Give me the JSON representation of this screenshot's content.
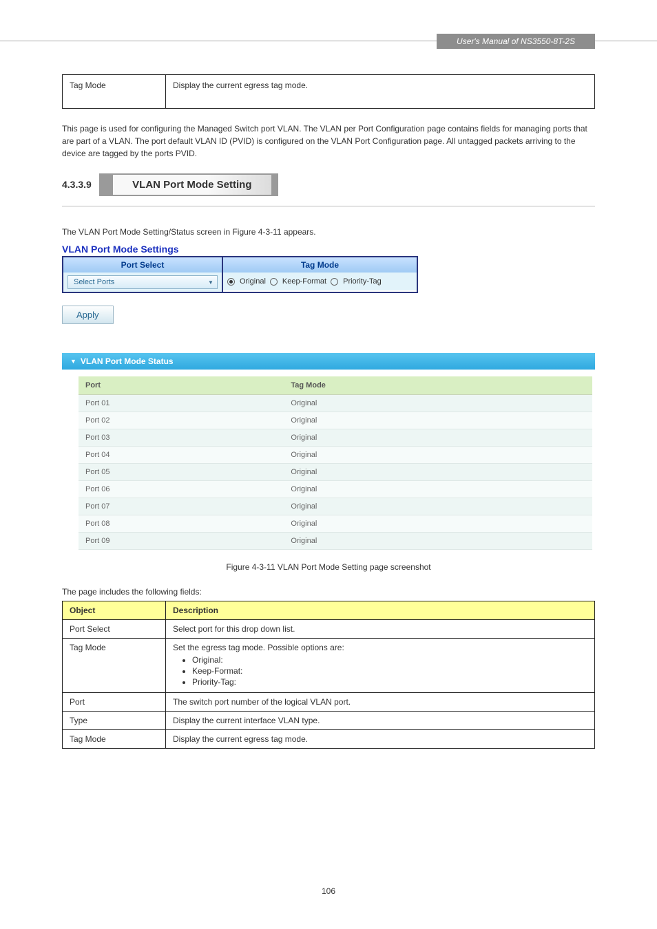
{
  "header": {
    "manual_title": "User's Manual of NS3550-8T-2S"
  },
  "top_row": {
    "label": "Tag Mode",
    "value": "Display the current egress tag mode."
  },
  "body_paragraph": "This page is used for configuring the Managed Switch port VLAN. The VLAN per Port Configuration page contains fields for managing ports that are part of a VLAN. The port default VLAN ID (PVID) is configured on the VLAN Port Configuration page. All untagged packets arriving to the device are tagged by the ports PVID.",
  "section": {
    "number": "4.3.3.9",
    "title": "VLAN Port Mode Setting"
  },
  "figure_intro": "The VLAN Port Mode Setting/Status screen in Figure 4-3-11 appears.",
  "settings_panel": {
    "title": "VLAN Port Mode Settings",
    "headers": {
      "port_select": "Port Select",
      "tag_mode": "Tag Mode"
    },
    "select_placeholder": "Select Ports",
    "radios": {
      "original": "Original",
      "keep_format": "Keep-Format",
      "priority_tag": "Priority-Tag"
    },
    "apply_label": "Apply"
  },
  "status_panel": {
    "title": "VLAN Port Mode Status",
    "columns": {
      "port": "Port",
      "tag_mode": "Tag Mode"
    },
    "rows": [
      {
        "port": "Port 01",
        "tag_mode": "Original"
      },
      {
        "port": "Port 02",
        "tag_mode": "Original"
      },
      {
        "port": "Port 03",
        "tag_mode": "Original"
      },
      {
        "port": "Port 04",
        "tag_mode": "Original"
      },
      {
        "port": "Port 05",
        "tag_mode": "Original"
      },
      {
        "port": "Port 06",
        "tag_mode": "Original"
      },
      {
        "port": "Port 07",
        "tag_mode": "Original"
      },
      {
        "port": "Port 08",
        "tag_mode": "Original"
      },
      {
        "port": "Port 09",
        "tag_mode": "Original"
      }
    ]
  },
  "figure_caption": "Figure 4-3-11 VLAN Port Mode Setting page screenshot",
  "desc_intro": "The page includes the following fields:",
  "desc_table": {
    "headers": {
      "object": "Object",
      "description": "Description"
    },
    "rows": [
      {
        "object": "Port Select",
        "description": "Select port for this drop down list."
      },
      {
        "object": "Tag Mode",
        "description_intro": "Set the egress tag mode. Possible options are:",
        "bullets": [
          "Original:",
          "Keep-Format:",
          "Priority-Tag:"
        ]
      },
      {
        "object": "Port",
        "description": "The switch port number of the logical VLAN port."
      },
      {
        "object": "Type",
        "description": "Display the current interface VLAN type."
      },
      {
        "object": "Tag Mode",
        "description": "Display the current egress tag mode."
      }
    ]
  },
  "page_number": "106"
}
